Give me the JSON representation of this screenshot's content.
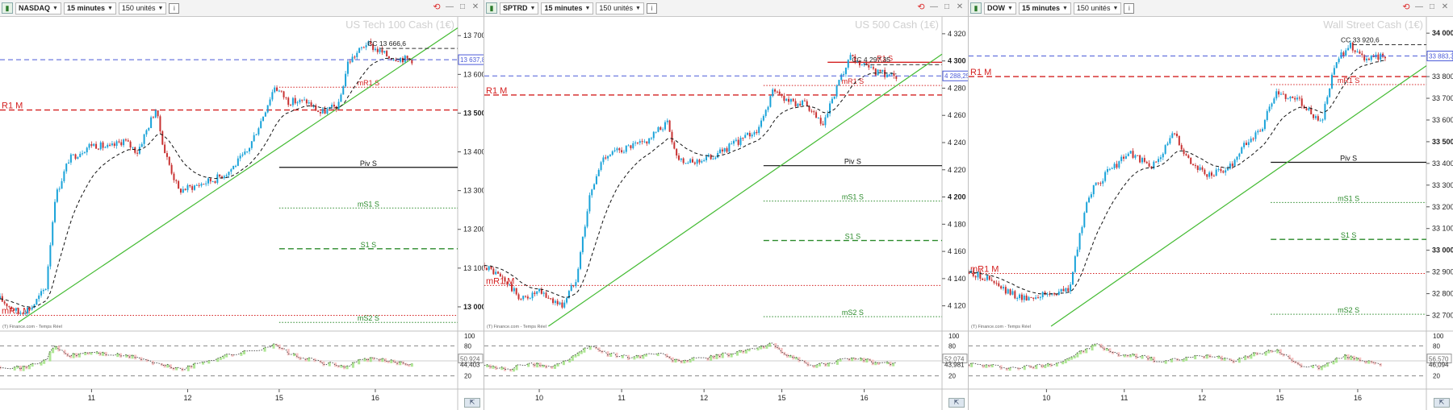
{
  "colors": {
    "candle_up": "#1aa3d9",
    "candle_down": "#c83232",
    "ma": "#111111",
    "trend": "#44bb33",
    "resistance": "#d42020",
    "support": "#2a8a2a",
    "pivot": "#111111",
    "price_line": "#4a5ad8",
    "osc_up": "#9be07a",
    "osc_down": "#f4b4b4"
  },
  "panels": [
    {
      "id": "nasdaq",
      "instrument": "NASDAQ",
      "timeframe": "15 minutes",
      "units": "150 unités",
      "watermark": "US Tech 100 Cash (1€)",
      "source": "(T) Finance.com - Temps Réel",
      "cc_label": "CC 13 666,6",
      "price_label": "13 637,8",
      "osc_labels": [
        "50,924",
        "44,403"
      ],
      "chart_data": {
        "type": "candlestick",
        "ylim": [
          12950,
          13740
        ],
        "yticks": [
          {
            "v": 13700,
            "t": "13 700"
          },
          {
            "v": 13600,
            "t": "13 600"
          },
          {
            "v": 13500,
            "t": "13 500",
            "bold": true
          },
          {
            "v": 13400,
            "t": "13 400"
          },
          {
            "v": 13300,
            "t": "13 300"
          },
          {
            "v": 13200,
            "t": "13 200"
          },
          {
            "v": 13100,
            "t": "13 100"
          },
          {
            "v": 13000,
            "t": "13 000",
            "bold": true
          }
        ],
        "xticks": [
          {
            "t": "11",
            "f": 0.2
          },
          {
            "t": "12",
            "f": 0.41
          },
          {
            "t": "15",
            "f": 0.61
          },
          {
            "t": "16",
            "f": 0.82
          }
        ],
        "series": [
          [
            0.0,
            13020
          ],
          [
            0.04,
            12985
          ],
          [
            0.07,
            13000
          ],
          [
            0.1,
            13050
          ],
          [
            0.12,
            13280
          ],
          [
            0.15,
            13380
          ],
          [
            0.2,
            13420
          ],
          [
            0.24,
            13410
          ],
          [
            0.27,
            13430
          ],
          [
            0.3,
            13400
          ],
          [
            0.34,
            13510
          ],
          [
            0.36,
            13400
          ],
          [
            0.39,
            13300
          ],
          [
            0.42,
            13310
          ],
          [
            0.47,
            13330
          ],
          [
            0.5,
            13350
          ],
          [
            0.54,
            13400
          ],
          [
            0.57,
            13480
          ],
          [
            0.6,
            13570
          ],
          [
            0.63,
            13530
          ],
          [
            0.67,
            13530
          ],
          [
            0.7,
            13500
          ],
          [
            0.74,
            13520
          ],
          [
            0.76,
            13630
          ],
          [
            0.8,
            13680
          ],
          [
            0.85,
            13645
          ],
          [
            0.9,
            13638
          ]
        ],
        "levels": [
          {
            "label": "R1 M",
            "v": 13508,
            "style": "resistance",
            "x0": 0,
            "x1": 1,
            "label_pos": "left"
          },
          {
            "label": "mR1 S",
            "v": 13567,
            "style": "resistance-dot",
            "x0": 0.61,
            "x1": 1,
            "label_pos": "mid"
          },
          {
            "label": "Piv S",
            "v": 13360,
            "style": "pivot",
            "x0": 0.61,
            "x1": 1,
            "label_pos": "mid"
          },
          {
            "label": "mS1 S",
            "v": 13255,
            "style": "support-dot",
            "x0": 0.61,
            "x1": 1,
            "label_pos": "mid"
          },
          {
            "label": "S1 S",
            "v": 13150,
            "style": "support",
            "x0": 0.61,
            "x1": 1,
            "label_pos": "mid"
          },
          {
            "label": "mR1 M",
            "v": 12978,
            "style": "resistance-dot",
            "x0": 0,
            "x1": 1,
            "label_pos": "left"
          },
          {
            "label": "mS2 S",
            "v": 12960,
            "style": "support-dot",
            "x0": 0.61,
            "x1": 1,
            "label_pos": "mid"
          }
        ],
        "trend": [
          [
            0.04,
            12960
          ],
          [
            1.0,
            13720
          ]
        ],
        "osc_yticks": [
          {
            "v": 100,
            "t": "100"
          },
          {
            "v": 80,
            "t": "80"
          },
          {
            "v": 50,
            "t": "50"
          },
          {
            "v": 20,
            "t": "20"
          }
        ],
        "osc": [
          [
            0.0,
            40
          ],
          [
            0.05,
            36
          ],
          [
            0.1,
            52
          ],
          [
            0.12,
            80
          ],
          [
            0.15,
            60
          ],
          [
            0.2,
            68
          ],
          [
            0.25,
            62
          ],
          [
            0.3,
            58
          ],
          [
            0.35,
            42
          ],
          [
            0.4,
            34
          ],
          [
            0.45,
            50
          ],
          [
            0.5,
            62
          ],
          [
            0.55,
            70
          ],
          [
            0.6,
            82
          ],
          [
            0.65,
            58
          ],
          [
            0.7,
            48
          ],
          [
            0.75,
            38
          ],
          [
            0.8,
            55
          ],
          [
            0.85,
            50
          ],
          [
            0.9,
            44
          ]
        ]
      }
    },
    {
      "id": "sptrd",
      "instrument": "SPTRD",
      "timeframe": "15 minutes",
      "units": "150 unités",
      "watermark": "US 500 Cash (1€)",
      "source": "(T) Finance.com - Temps Réel",
      "cc_label": "CC 4 297,35",
      "price_label": "4 288,25",
      "osc_labels": [
        "52,074",
        "43,981"
      ],
      "chart_data": {
        "type": "candlestick",
        "ylim": [
          4105,
          4330
        ],
        "yticks": [
          {
            "v": 4320,
            "t": "4 320"
          },
          {
            "v": 4300,
            "t": "4 300",
            "bold": true
          },
          {
            "v": 4280,
            "t": "4 280"
          },
          {
            "v": 4260,
            "t": "4 260"
          },
          {
            "v": 4240,
            "t": "4 240"
          },
          {
            "v": 4220,
            "t": "4 220"
          },
          {
            "v": 4200,
            "t": "4 200",
            "bold": true
          },
          {
            "v": 4180,
            "t": "4 180"
          },
          {
            "v": 4160,
            "t": "4 160"
          },
          {
            "v": 4140,
            "t": "4 140"
          },
          {
            "v": 4120,
            "t": "4 120"
          }
        ],
        "xticks": [
          {
            "t": "10",
            "f": 0.12
          },
          {
            "t": "11",
            "f": 0.3
          },
          {
            "t": "12",
            "f": 0.48
          },
          {
            "t": "15",
            "f": 0.65
          },
          {
            "t": "16",
            "f": 0.83
          }
        ],
        "series": [
          [
            0.0,
            4150
          ],
          [
            0.04,
            4140
          ],
          [
            0.08,
            4125
          ],
          [
            0.12,
            4130
          ],
          [
            0.17,
            4120
          ],
          [
            0.2,
            4140
          ],
          [
            0.23,
            4200
          ],
          [
            0.26,
            4230
          ],
          [
            0.3,
            4235
          ],
          [
            0.35,
            4240
          ],
          [
            0.4,
            4255
          ],
          [
            0.42,
            4230
          ],
          [
            0.45,
            4225
          ],
          [
            0.5,
            4230
          ],
          [
            0.55,
            4240
          ],
          [
            0.6,
            4250
          ],
          [
            0.63,
            4278
          ],
          [
            0.67,
            4270
          ],
          [
            0.7,
            4268
          ],
          [
            0.74,
            4252
          ],
          [
            0.77,
            4280
          ],
          [
            0.8,
            4302
          ],
          [
            0.85,
            4292
          ],
          [
            0.9,
            4289
          ]
        ],
        "levels": [
          {
            "label": "R1 M",
            "v": 4275,
            "style": "resistance",
            "x0": 0,
            "x1": 1,
            "label_pos": "left"
          },
          {
            "label": "mR1 S",
            "v": 4282,
            "style": "resistance-dot",
            "x0": 0.61,
            "x1": 1,
            "label_pos": "mid"
          },
          {
            "label": "R1 S",
            "v": 4299,
            "style": "resistance-solid",
            "x0": 0.75,
            "x1": 1,
            "label_pos": "mid"
          },
          {
            "label": "Piv S",
            "v": 4223,
            "style": "pivot",
            "x0": 0.61,
            "x1": 1,
            "label_pos": "mid"
          },
          {
            "label": "mS1 S",
            "v": 4197,
            "style": "support-dot",
            "x0": 0.61,
            "x1": 1,
            "label_pos": "mid"
          },
          {
            "label": "S1 S",
            "v": 4168,
            "style": "support",
            "x0": 0.61,
            "x1": 1,
            "label_pos": "mid"
          },
          {
            "label": "mR1 M",
            "v": 4135,
            "style": "resistance-dot",
            "x0": 0,
            "x1": 1,
            "label_pos": "left"
          },
          {
            "label": "mS2 S",
            "v": 4112,
            "style": "support-dot",
            "x0": 0.61,
            "x1": 1,
            "label_pos": "mid"
          }
        ],
        "trend": [
          [
            0.14,
            4105
          ],
          [
            1.0,
            4305
          ]
        ],
        "osc_yticks": [
          {
            "v": 100,
            "t": "100"
          },
          {
            "v": 80,
            "t": "80"
          },
          {
            "v": 50,
            "t": "50"
          },
          {
            "v": 20,
            "t": "20"
          }
        ],
        "osc": [
          [
            0.0,
            40
          ],
          [
            0.05,
            34
          ],
          [
            0.1,
            44
          ],
          [
            0.15,
            40
          ],
          [
            0.2,
            60
          ],
          [
            0.23,
            82
          ],
          [
            0.27,
            64
          ],
          [
            0.32,
            58
          ],
          [
            0.38,
            66
          ],
          [
            0.42,
            50
          ],
          [
            0.48,
            56
          ],
          [
            0.52,
            62
          ],
          [
            0.58,
            72
          ],
          [
            0.63,
            84
          ],
          [
            0.67,
            58
          ],
          [
            0.72,
            40
          ],
          [
            0.77,
            50
          ],
          [
            0.82,
            54
          ],
          [
            0.86,
            46
          ],
          [
            0.9,
            44
          ]
        ]
      }
    },
    {
      "id": "dow",
      "instrument": "DOW",
      "timeframe": "15 minutes",
      "units": "150 unités",
      "watermark": "Wall Street Cash (1€)",
      "source": "(T) Finance.com - Temps Réel",
      "cc_label": "CC 33 920,6",
      "price_label": "33 883,3",
      "osc_labels": [
        "56,570",
        "46,094"
      ],
      "chart_data": {
        "type": "candlestick",
        "ylim": [
          32650,
          34060
        ],
        "yticks": [
          {
            "v": 34000,
            "t": "34 000",
            "bold": true
          },
          {
            "v": 33900,
            "t": "33 900"
          },
          {
            "v": 33800,
            "t": "33 800"
          },
          {
            "v": 33700,
            "t": "33 700"
          },
          {
            "v": 33600,
            "t": "33 600"
          },
          {
            "v": 33500,
            "t": "33 500",
            "bold": true
          },
          {
            "v": 33400,
            "t": "33 400"
          },
          {
            "v": 33300,
            "t": "33 300"
          },
          {
            "v": 33200,
            "t": "33 200"
          },
          {
            "v": 33100,
            "t": "33 100"
          },
          {
            "v": 33000,
            "t": "33 000",
            "bold": true
          },
          {
            "v": 32900,
            "t": "32 900"
          },
          {
            "v": 32800,
            "t": "32 800"
          },
          {
            "v": 32700,
            "t": "32 700"
          }
        ],
        "xticks": [
          {
            "t": "10",
            "f": 0.17
          },
          {
            "t": "11",
            "f": 0.34
          },
          {
            "t": "12",
            "f": 0.51
          },
          {
            "t": "15",
            "f": 0.68
          },
          {
            "t": "16",
            "f": 0.85
          }
        ],
        "series": [
          [
            0.0,
            32900
          ],
          [
            0.04,
            32870
          ],
          [
            0.08,
            32810
          ],
          [
            0.12,
            32780
          ],
          [
            0.18,
            32800
          ],
          [
            0.22,
            32820
          ],
          [
            0.26,
            33250
          ],
          [
            0.3,
            33350
          ],
          [
            0.35,
            33450
          ],
          [
            0.4,
            33380
          ],
          [
            0.45,
            33540
          ],
          [
            0.48,
            33420
          ],
          [
            0.52,
            33340
          ],
          [
            0.57,
            33380
          ],
          [
            0.6,
            33480
          ],
          [
            0.64,
            33560
          ],
          [
            0.67,
            33720
          ],
          [
            0.72,
            33700
          ],
          [
            0.77,
            33580
          ],
          [
            0.8,
            33850
          ],
          [
            0.83,
            33950
          ],
          [
            0.87,
            33880
          ],
          [
            0.91,
            33895
          ]
        ],
        "levels": [
          {
            "label": "R1 M",
            "v": 33800,
            "style": "resistance",
            "x0": 0,
            "x1": 1,
            "label_pos": "left"
          },
          {
            "label": "mR1 S",
            "v": 33763,
            "style": "resistance-dot",
            "x0": 0.66,
            "x1": 1,
            "label_pos": "mid"
          },
          {
            "label": "Piv S",
            "v": 33405,
            "style": "pivot",
            "x0": 0.66,
            "x1": 1,
            "label_pos": "mid"
          },
          {
            "label": "mS1 S",
            "v": 33220,
            "style": "support-dot",
            "x0": 0.66,
            "x1": 1,
            "label_pos": "mid"
          },
          {
            "label": "S1 S",
            "v": 33050,
            "style": "support",
            "x0": 0.66,
            "x1": 1,
            "label_pos": "mid"
          },
          {
            "label": "mR1 M",
            "v": 32893,
            "style": "resistance-dot",
            "x0": 0,
            "x1": 1,
            "label_pos": "left"
          },
          {
            "label": "mS2 S",
            "v": 32705,
            "style": "support-dot",
            "x0": 0.66,
            "x1": 1,
            "label_pos": "mid"
          }
        ],
        "trend": [
          [
            0.18,
            32650
          ],
          [
            1.0,
            33850
          ]
        ],
        "osc_yticks": [
          {
            "v": 100,
            "t": "100"
          },
          {
            "v": 80,
            "t": "80"
          },
          {
            "v": 50,
            "t": "50"
          },
          {
            "v": 20,
            "t": "20"
          }
        ],
        "osc": [
          [
            0.0,
            44
          ],
          [
            0.05,
            40
          ],
          [
            0.1,
            36
          ],
          [
            0.15,
            40
          ],
          [
            0.2,
            48
          ],
          [
            0.25,
            70
          ],
          [
            0.28,
            84
          ],
          [
            0.32,
            64
          ],
          [
            0.38,
            60
          ],
          [
            0.42,
            48
          ],
          [
            0.48,
            56
          ],
          [
            0.53,
            62
          ],
          [
            0.58,
            52
          ],
          [
            0.63,
            66
          ],
          [
            0.68,
            70
          ],
          [
            0.72,
            42
          ],
          [
            0.77,
            38
          ],
          [
            0.82,
            60
          ],
          [
            0.86,
            52
          ],
          [
            0.9,
            46
          ]
        ]
      }
    }
  ]
}
